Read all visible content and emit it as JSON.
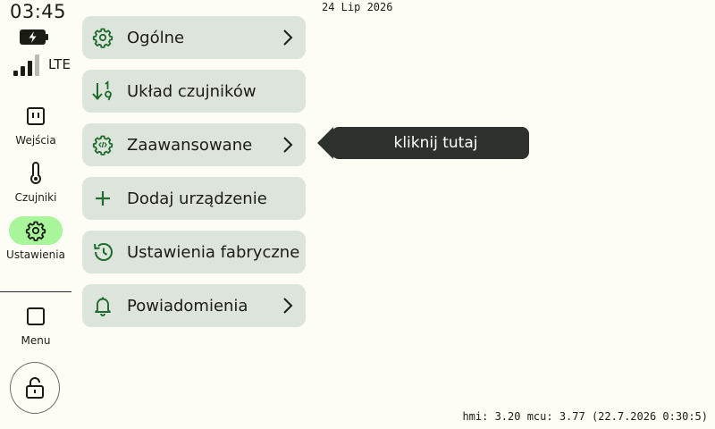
{
  "status": {
    "time": "03:45",
    "network": "LTE",
    "icons": {
      "battery": "battery-charging-icon",
      "signal": "signal-icon"
    }
  },
  "date": "24 Lip 2026",
  "nav": {
    "items": [
      {
        "label": "Wejścia",
        "icon": "input-icon",
        "active": false
      },
      {
        "label": "Czujniki",
        "icon": "thermometer-icon",
        "active": false
      },
      {
        "label": "Ustawienia",
        "icon": "gear-icon",
        "active": true
      },
      {
        "label": "Menu",
        "icon": "square-icon",
        "active": false
      }
    ],
    "lock_icon": "lock-open-icon"
  },
  "settings_menu": {
    "items": [
      {
        "label": "Ogólne",
        "icon": "gear-icon",
        "chevron": true
      },
      {
        "label": "Układ czujników",
        "icon": "sort-numeric-icon",
        "chevron": false
      },
      {
        "label": "Zaawansowane",
        "icon": "code-gear-icon",
        "chevron": true
      },
      {
        "label": "Dodaj urządzenie",
        "icon": "plus-icon",
        "chevron": false
      },
      {
        "label": "Ustawienia fabryczne",
        "icon": "history-icon",
        "chevron": false
      },
      {
        "label": "Powiadomienia",
        "icon": "bell-icon",
        "chevron": true
      }
    ]
  },
  "tooltip": {
    "text": "kliknij tutaj"
  },
  "footer": {
    "version": "hmi: 3.20 mcu: 3.77 (22.7.2026 0:30:5)"
  },
  "colors": {
    "background": "#fdfdf5",
    "menu_item": "#dde4dc",
    "accent_green": "#1e6b2c",
    "active_pill": "#a8f59a",
    "tooltip_bg": "#2d322d"
  }
}
